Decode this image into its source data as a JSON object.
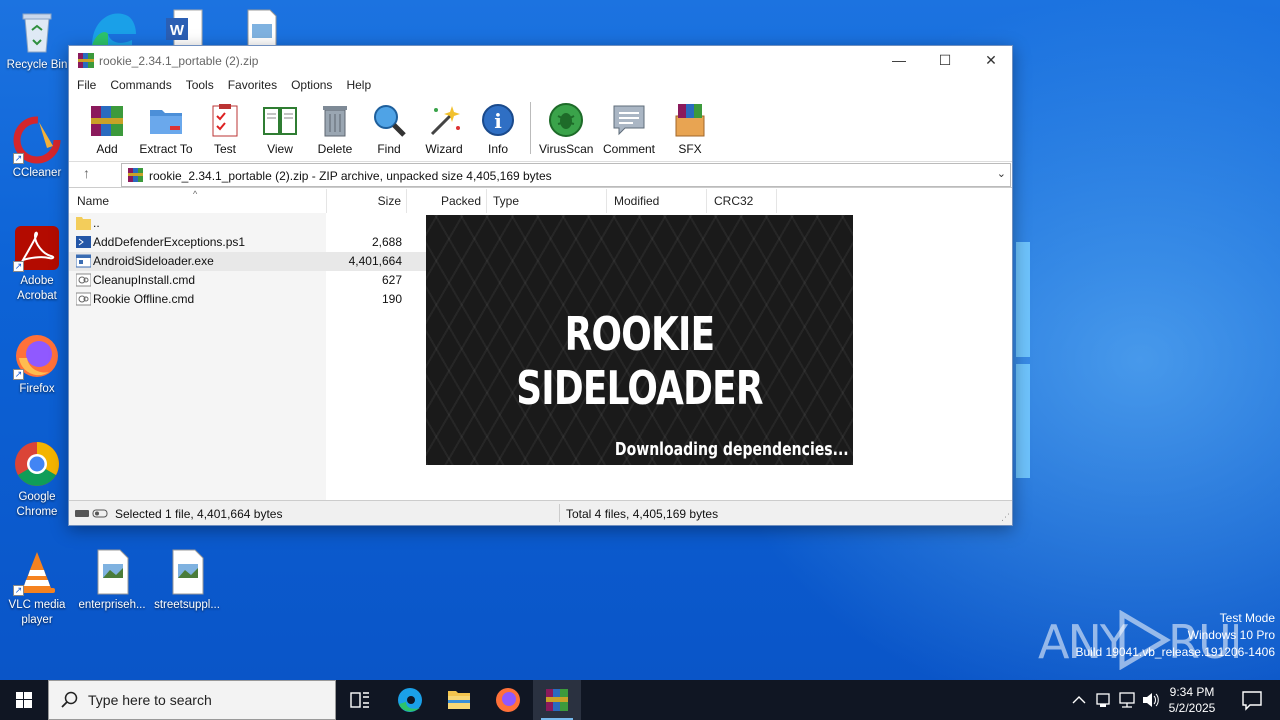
{
  "desktop": {
    "icons": [
      {
        "label": "Recycle Bin"
      },
      {
        "label": "CCleaner"
      },
      {
        "label": "Adobe Acrobat"
      },
      {
        "label": "Firefox"
      },
      {
        "label": "Google Chrome"
      },
      {
        "label": "VLC media player"
      },
      {
        "label": "enterpriseh..."
      },
      {
        "label": "streetsuppl..."
      }
    ]
  },
  "window": {
    "title": "rookie_2.34.1_portable (2).zip",
    "menu": [
      "File",
      "Commands",
      "Tools",
      "Favorites",
      "Options",
      "Help"
    ],
    "toolbar": [
      "Add",
      "Extract To",
      "Test",
      "View",
      "Delete",
      "Find",
      "Wizard",
      "Info",
      "VirusScan",
      "Comment",
      "SFX"
    ],
    "address": "rookie_2.34.1_portable (2).zip - ZIP archive, unpacked size 4,405,169 bytes",
    "columns": [
      "Name",
      "Size",
      "Packed",
      "Type",
      "Modified",
      "CRC32"
    ],
    "files": [
      {
        "name": "..",
        "size": ""
      },
      {
        "name": "AddDefenderExceptions.ps1",
        "size": "2,688"
      },
      {
        "name": "AndroidSideloader.exe",
        "size": "4,401,664"
      },
      {
        "name": "CleanupInstall.cmd",
        "size": "627"
      },
      {
        "name": "Rookie Offline.cmd",
        "size": "190"
      }
    ],
    "status_left": "Selected 1 file, 4,401,664 bytes",
    "status_right": "Total 4 files, 4,405,169 bytes"
  },
  "splash": {
    "title": "ROOKIE SIDELOADER",
    "message": "Downloading dependencies..."
  },
  "watermark": {
    "logo": "ANY RUN",
    "line1": "Test Mode",
    "line2": "Windows 10 Pro",
    "line3": "Build 19041.vb_release.191206-1406"
  },
  "taskbar": {
    "search_placeholder": "Type here to search",
    "time": "9:34 PM",
    "date": "5/2/2025"
  },
  "colors": {
    "desktop_blue": "#0d63d6",
    "taskbar": "#101623",
    "splash_bg": "#1a1a1a"
  }
}
